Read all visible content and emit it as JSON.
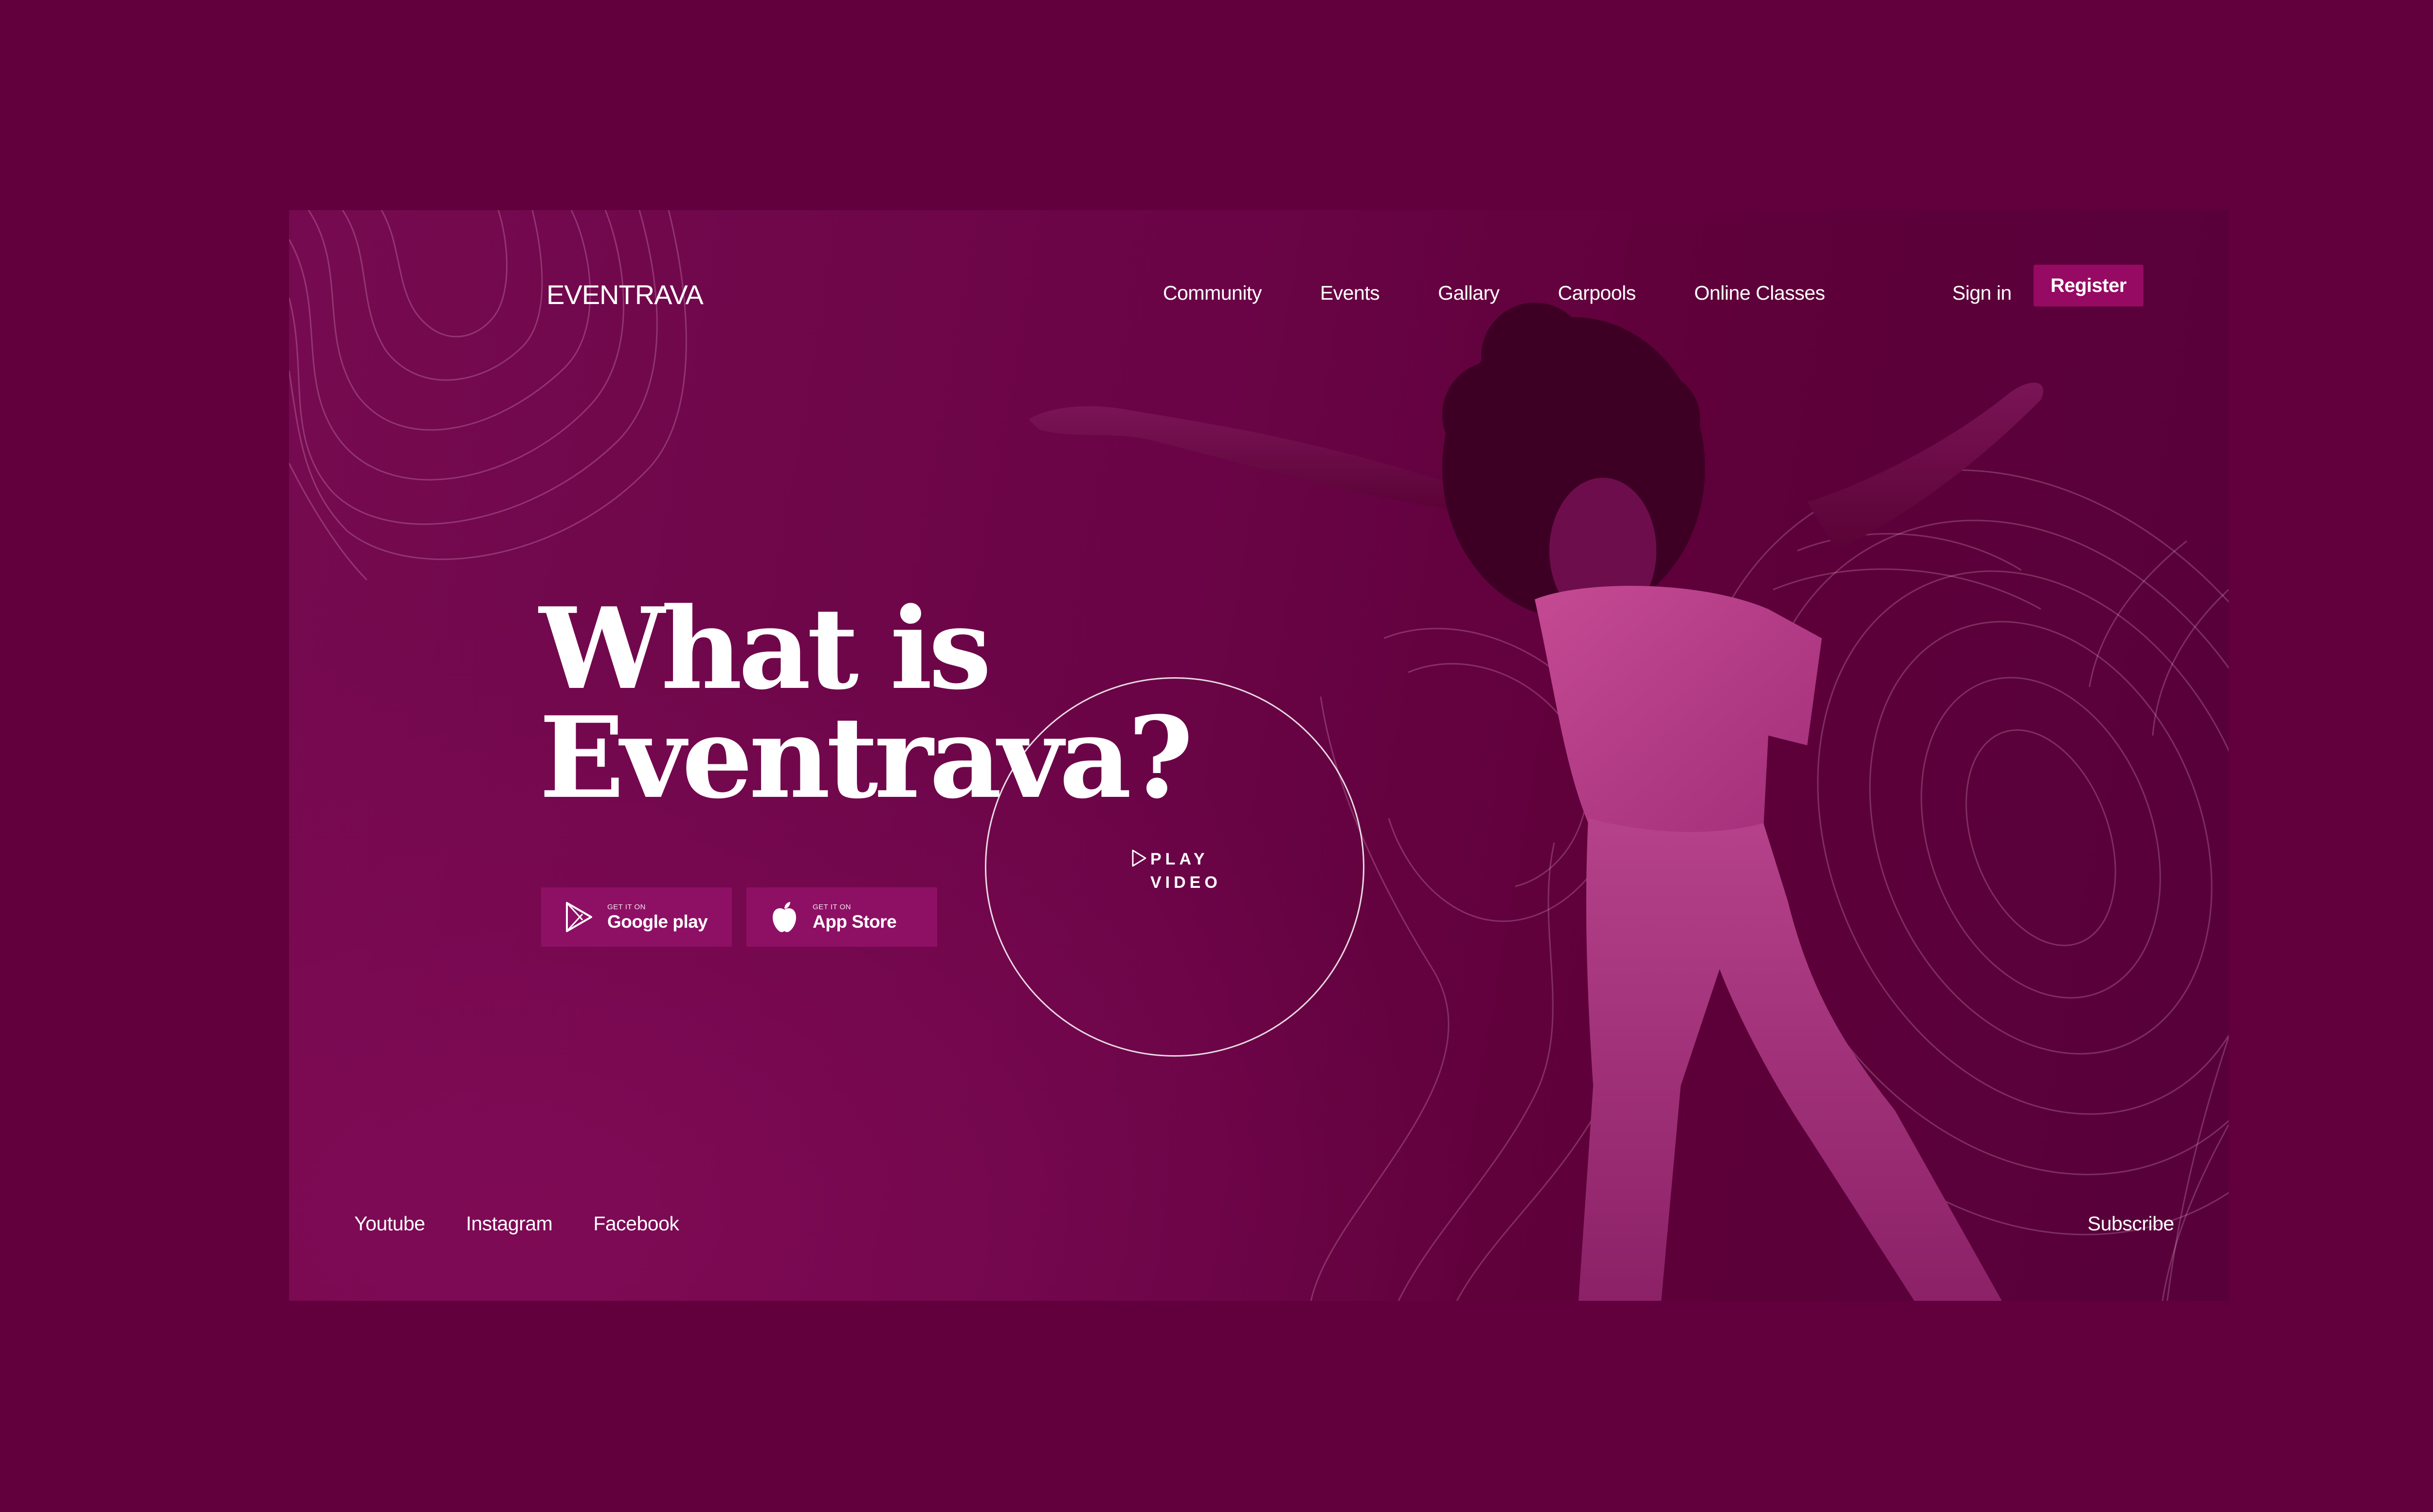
{
  "brand": {
    "logo_text": "EVENTRAVA"
  },
  "nav": {
    "items": [
      {
        "label": "Community"
      },
      {
        "label": "Events"
      },
      {
        "label": "Gallary"
      },
      {
        "label": "Carpools"
      },
      {
        "label": "Online Classes"
      }
    ],
    "sign_in": "Sign in",
    "register": "Register"
  },
  "hero": {
    "title_line1": "What is",
    "title_line2": "Eventrava?",
    "play_line1": "PLAY",
    "play_line2": "VIDEO"
  },
  "stores": {
    "google": {
      "small": "GET IT ON",
      "big": "Google play",
      "icon": "google-play-icon"
    },
    "apple": {
      "small": "GET IT ON",
      "big": "App Store",
      "icon": "apple-icon"
    }
  },
  "footer": {
    "social": [
      {
        "label": "Youtube"
      },
      {
        "label": "Instagram"
      },
      {
        "label": "Facebook"
      }
    ],
    "subscribe": "Subscribe"
  },
  "colors": {
    "background": "#62003d",
    "hero": "#6a0446",
    "accent": "#960a63",
    "store_button": "#8e1065",
    "text": "#ffffff"
  }
}
